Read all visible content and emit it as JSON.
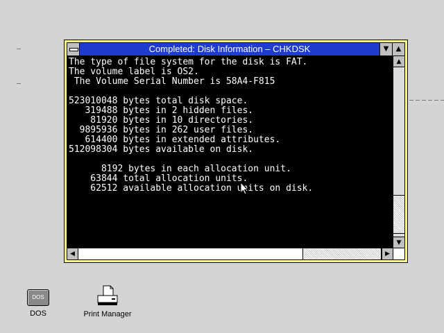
{
  "window": {
    "title": "Completed: Disk Information – CHKDSK",
    "minimize_glyph": "▼",
    "maximize_glyph": "▲"
  },
  "console": {
    "lines": [
      "The type of file system for the disk is FAT.",
      "The volume label is OS2.",
      " The Volume Serial Number is 58A4-F815",
      "",
      "523010048 bytes total disk space.",
      "   319488 bytes in 2 hidden files.",
      "    81920 bytes in 10 directories.",
      "  9895936 bytes in 262 user files.",
      "   614400 bytes in extended attributes.",
      "512098304 bytes available on disk.",
      "",
      "      8192 bytes in each allocation unit.",
      "    63844 total allocation units.",
      "    62512 available allocation units on disk."
    ]
  },
  "scrollbars": {
    "up_glyph": "▲",
    "down_glyph": "▼",
    "left_glyph": "◀",
    "right_glyph": "▶"
  },
  "desktop_icons": {
    "dos": {
      "badge": "DOS",
      "label": "DOS",
      "icon": "dos-icon"
    },
    "print_manager": {
      "label": "Print Manager",
      "icon": "printer-icon"
    }
  },
  "colors": {
    "title_bar": "#1e3ccf",
    "window_frame": "#ffff80",
    "console_bg": "#000000",
    "console_fg": "#ffffff",
    "desktop": "#d4d4d4"
  }
}
